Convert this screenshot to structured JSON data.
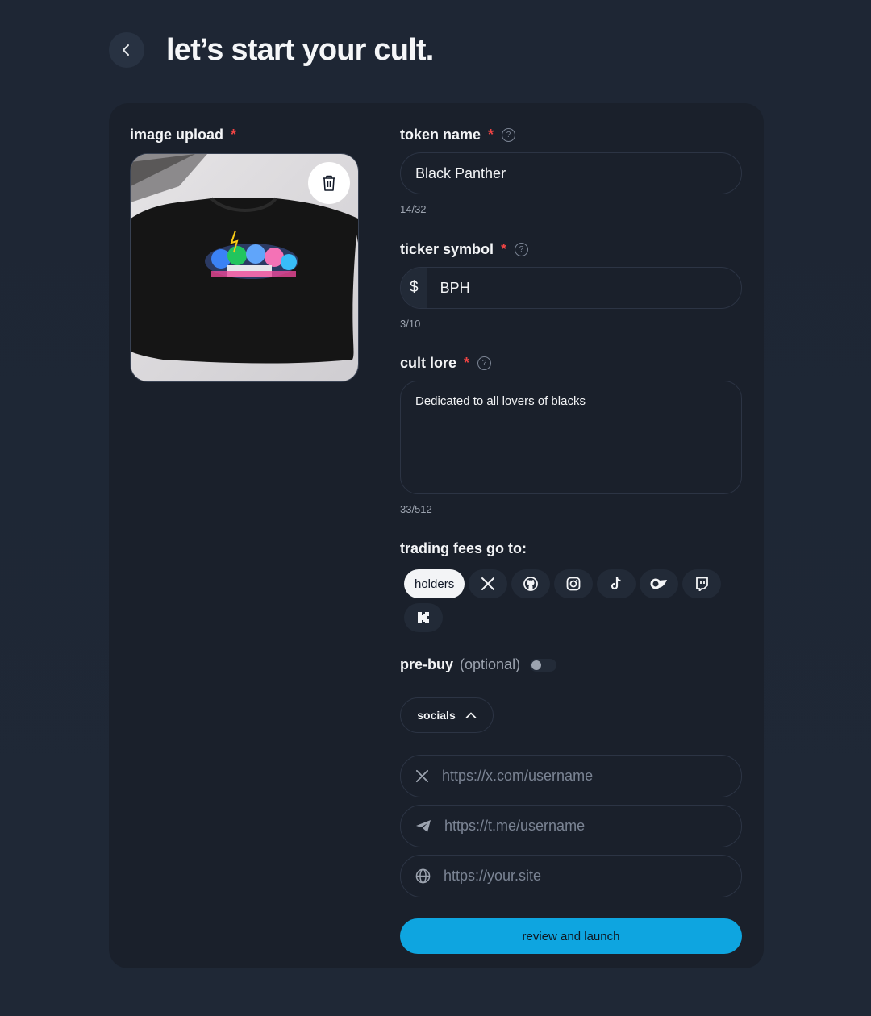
{
  "header": {
    "title": "let’s start your cult."
  },
  "image_upload": {
    "label": "image upload",
    "required": "*"
  },
  "token_name": {
    "label": "token name",
    "required": "*",
    "value": "Black Panther",
    "counter": "14/32"
  },
  "ticker": {
    "label": "ticker symbol",
    "required": "*",
    "prefix": "$",
    "value": "BPH",
    "counter": "3/10"
  },
  "lore": {
    "label": "cult lore",
    "required": "*",
    "value": "Dedicated to all lovers of blacks",
    "counter": "33/512"
  },
  "fees": {
    "label": "trading fees go to:",
    "options": [
      {
        "label": "holders",
        "icon": "",
        "active": true
      },
      {
        "label": "",
        "icon": "x-icon"
      },
      {
        "label": "",
        "icon": "github-icon"
      },
      {
        "label": "",
        "icon": "instagram-icon"
      },
      {
        "label": "",
        "icon": "tiktok-icon"
      },
      {
        "label": "",
        "icon": "onlyfans-icon"
      },
      {
        "label": "",
        "icon": "twitch-icon"
      },
      {
        "label": "",
        "icon": "kick-icon"
      }
    ]
  },
  "prebuy": {
    "label": "pre-buy",
    "optional": "(optional)",
    "enabled": false
  },
  "socials": {
    "label": "socials",
    "x_placeholder": "https://x.com/username",
    "telegram_placeholder": "https://t.me/username",
    "website_placeholder": "https://your.site"
  },
  "launch": {
    "label": "review and launch"
  },
  "colors": {
    "accent": "#0ea5e0",
    "required": "#ef4444",
    "card": "#1a202b",
    "page": "#1f2836"
  }
}
